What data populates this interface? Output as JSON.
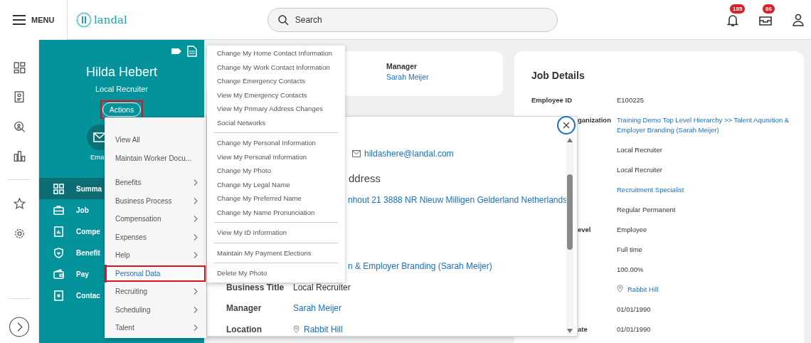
{
  "topbar": {
    "menu_label": "MENU",
    "logo_text": "landal",
    "search_placeholder": "Search",
    "notifications_count": "185",
    "inbox_count": "86"
  },
  "profile": {
    "name": "Hilda Hebert",
    "title": "Local Recruiter",
    "actions_label": "Actions",
    "actions_highlighted": true,
    "email_label": "Ema"
  },
  "profile_nav": [
    {
      "label": "Summa",
      "kind": "grid",
      "selected": true
    },
    {
      "label": "Job",
      "kind": "briefcase",
      "selected": false
    },
    {
      "label": "Compe",
      "kind": "chart",
      "selected": false
    },
    {
      "label": "Benefit",
      "kind": "shield",
      "selected": false
    },
    {
      "label": "Pay",
      "kind": "wallet",
      "selected": false
    },
    {
      "label": "Contac",
      "kind": "contact",
      "selected": false
    }
  ],
  "summary_card": {
    "label": "Manager",
    "value": "Sarah Meijer"
  },
  "job_details": {
    "title": "Job Details",
    "rows": [
      {
        "label": "Employee ID",
        "value": "E100225",
        "kind": "text"
      },
      {
        "label": "ganization",
        "covered": true,
        "value": "Training Demo Top Level Hierarchy >> Talent Aquisition & Employer Branding (Sarah Meijer)",
        "kind": "link"
      },
      {
        "value": "Local Recruiter",
        "kind": "text"
      },
      {
        "value": "Local Recruiter",
        "kind": "text"
      },
      {
        "value": "Recruitment Specialist",
        "kind": "link"
      },
      {
        "value": "Regular Permanent",
        "kind": "text"
      },
      {
        "label": "evel",
        "covered": true,
        "value": "Employee",
        "kind": "text"
      },
      {
        "value": "Full time",
        "kind": "text"
      },
      {
        "value": "100.00%",
        "kind": "text"
      },
      {
        "value": "Rabbit Hill",
        "kind": "location"
      },
      {
        "value": "01/01/1990",
        "kind": "text"
      },
      {
        "label": "ate",
        "covered": true,
        "value": "01/01/1990",
        "kind": "text"
      }
    ]
  },
  "popup": {
    "email": "hildashere@landal.com",
    "heading": "ddress",
    "address": "nhout 21 3888 NR Nieuw Milligen Gelderland Netherlands",
    "organization": "n & Employer Branding (Sarah Meijer)",
    "fields": [
      {
        "label": "Business Title",
        "value": "Local Recruiter",
        "kind": "text"
      },
      {
        "label": "Manager",
        "value": "Sarah Meijer",
        "kind": "link"
      },
      {
        "label": "Location",
        "value": "Rabbit Hill",
        "kind": "location"
      }
    ]
  },
  "actions_menu": {
    "groups": [
      [
        {
          "label": "View All",
          "has_submenu": false,
          "selected": false,
          "highlighted": false
        },
        {
          "label": "Maintain Worker Docu...",
          "has_submenu": false,
          "selected": false,
          "highlighted": false
        }
      ],
      [
        {
          "label": "Benefits",
          "has_submenu": true,
          "selected": false,
          "highlighted": false
        },
        {
          "label": "Business Process",
          "has_submenu": true,
          "selected": false,
          "highlighted": false
        },
        {
          "label": "Compensation",
          "has_submenu": true,
          "selected": false,
          "highlighted": false
        },
        {
          "label": "Expenses",
          "has_submenu": true,
          "selected": false,
          "highlighted": false
        },
        {
          "label": "Help",
          "has_submenu": true,
          "selected": false,
          "highlighted": false
        },
        {
          "label": "Personal Data",
          "has_submenu": false,
          "selected": true,
          "highlighted": true
        },
        {
          "label": "Recruiting",
          "has_submenu": true,
          "selected": false,
          "highlighted": false
        },
        {
          "label": "Scheduling",
          "has_submenu": true,
          "selected": false,
          "highlighted": false
        },
        {
          "label": "Talent",
          "has_submenu": true,
          "selected": false,
          "highlighted": false
        }
      ]
    ]
  },
  "submenu": {
    "groups": [
      [
        "Change My Home Contact Information",
        "Change My Work Contact Information",
        "Change Emergency Contacts",
        "View My Emergency Contacts",
        "View My Primary Address Changes",
        "Social Networks"
      ],
      [
        "Change My Personal Information",
        "View My Personal Information",
        "Change My Photo",
        "Change My Legal Name",
        "Change My Preferred Name",
        "Change My Name Pronunciation"
      ],
      [
        "View My ID Information"
      ],
      [
        "Maintain My Payment Elections"
      ],
      [
        "Delete My Photo"
      ]
    ]
  }
}
